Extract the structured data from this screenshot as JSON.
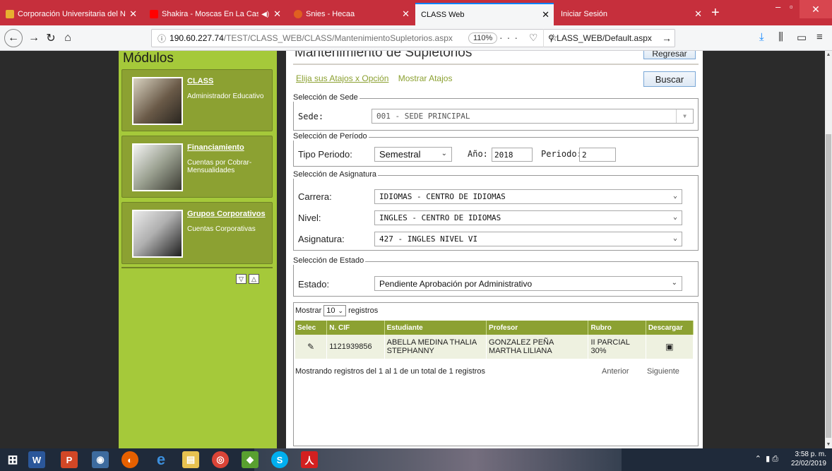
{
  "browser": {
    "tabs": [
      {
        "label": "Corporación Universitaria del N",
        "active": false,
        "icon_color": "#e8b030"
      },
      {
        "label": "Shakira - Moscas En La Casa",
        "active": false,
        "icon_color": "#ff0000",
        "sound": "◀)"
      },
      {
        "label": "Snies - Hecaa",
        "active": false,
        "icon_color": "#e06020"
      },
      {
        "label": "CLASS Web",
        "active": true,
        "icon_color": "#f5f6f7"
      },
      {
        "label": "Iniciar Sesión",
        "active": false,
        "icon_color": "#c62f3c"
      }
    ],
    "new_tab": "+",
    "url_host": "190.60.227.74",
    "url_path": "/TEST/CLASS_WEB/CLASS/MantenimientoSupletorios.aspx",
    "zoom": "110%",
    "search_text": "LASS_WEB/Default.aspx"
  },
  "sidebar": {
    "title": "Módulos",
    "modules": [
      {
        "title": "CLASS",
        "desc": "Administrador Educativo"
      },
      {
        "title": "Financiamiento",
        "desc": "Cuentas por Cobrar-Mensualidades"
      },
      {
        "title": "Grupos Corporativos",
        "desc": "Cuentas Corporativas"
      }
    ]
  },
  "main": {
    "title": "Mantenimiento de Supletorios",
    "regresar": "Regresar",
    "buscar": "Buscar",
    "link_atajos": "Elija sus Atajos x Opción",
    "link_mostrar": "Mostrar Atajos",
    "sede": {
      "legend": "Selección de Sede",
      "label": "Sede:",
      "value": "001 - SEDE PRINCIPAL"
    },
    "periodo": {
      "legend": "Selección de Período",
      "tipo_label": "Tipo Periodo:",
      "tipo_value": "Semestral",
      "anio_label": "Año:",
      "anio_value": "2018",
      "periodo_label": "Periodo:",
      "periodo_value": "2"
    },
    "asignatura": {
      "legend": "Selección de Asignatura",
      "carrera_label": "Carrera:",
      "carrera_value": "IDIOMAS - CENTRO DE IDIOMAS",
      "nivel_label": "Nivel:",
      "nivel_value": "INGLES - CENTRO DE IDIOMAS",
      "asig_label": "Asignatura:",
      "asig_value": "427 - INGLES NIVEL VI"
    },
    "estado": {
      "legend": "Selección de Estado",
      "label": "Estado:",
      "value": "Pendiente Aprobación por Administrativo"
    },
    "grid": {
      "show_prefix": "Mostrar",
      "show_value": "10",
      "show_suffix": "registros",
      "headers": [
        "Selec",
        "N. CIF",
        "Estudiante",
        "Profesor",
        "Rubro",
        "Descargar"
      ],
      "rows": [
        {
          "cif": "1121939856",
          "estudiante": "ABELLA MEDINA THALIA STEPHANNY",
          "profesor": "GONZALEZ PEÑA MARTHA LILIANA",
          "rubro": "II PARCIAL 30%"
        }
      ],
      "info": "Mostrando registros del 1 al 1 de un total de 1 registros",
      "prev": "Anterior",
      "next": "Siguiente"
    }
  },
  "taskbar": {
    "time": "3:58 p. m.",
    "date": "22/02/2019"
  }
}
